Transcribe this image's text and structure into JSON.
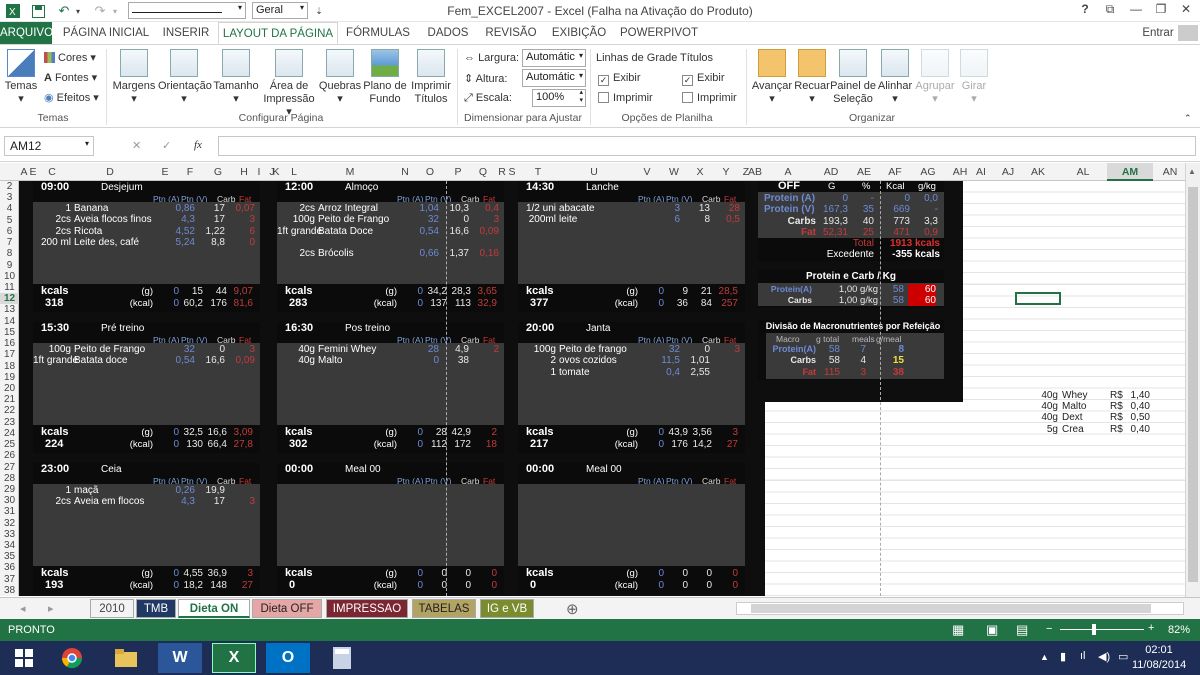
{
  "window": {
    "title": "Fem_EXCEL2007 - Excel (Falha na Ativação do Produto)",
    "help": "?",
    "signin": "Entrar"
  },
  "qat": {
    "font_box": "",
    "size_box": "Geral"
  },
  "ribbon_tabs": [
    "ARQUIVO",
    "PÁGINA INICIAL",
    "INSERIR",
    "LAYOUT DA PÁGINA",
    "FÓRMULAS",
    "DADOS",
    "REVISÃO",
    "EXIBIÇÃO",
    "POWERPIVOT"
  ],
  "ribbon": {
    "temas": "Temas",
    "cores": "Cores",
    "fontes": "Fontes",
    "efeitos": "Efeitos",
    "temas_group": "Temas",
    "margens": "Margens",
    "orientacao": "Orientação",
    "tamanho": "Tamanho",
    "area1": "Área de",
    "area2": "Impressão",
    "quebras": "Quebras",
    "plano1": "Plano de",
    "plano2": "Fundo",
    "imprimir1": "Imprimir",
    "imprimir2": "Títulos",
    "config_group": "Configurar Página",
    "largura": "Largura:",
    "largura_val": "Automátic",
    "altura": "Altura:",
    "altura_val": "Automátic",
    "escala": "Escala:",
    "escala_val": "100%",
    "dim_group": "Dimensionar para Ajustar",
    "linhas": "Linhas de Grade",
    "titulos": "Títulos",
    "exibir": "Exibir",
    "imprimir": "Imprimir",
    "opcoes_group": "Opções de Planilha",
    "avancar": "Avançar",
    "recuar": "Recuar",
    "painel1": "Painel de",
    "painel2": "Seleção",
    "alinhar": "Alinhar",
    "agrupar": "Agrupar",
    "girar": "Girar",
    "organizar_group": "Organizar"
  },
  "formula_bar": {
    "name_box": "AM12",
    "fx": "fx",
    "cancel": "✕",
    "enter": "✓"
  },
  "columns": [
    "A",
    "E",
    "C",
    "D",
    "E",
    "F",
    "G",
    "H",
    "I",
    "J",
    "K",
    "L",
    "M",
    "N",
    "O",
    "P",
    "Q",
    "R",
    "S",
    "T",
    "U",
    "V",
    "W",
    "X",
    "Y",
    "Z",
    "AB",
    "A",
    "AD",
    "AE",
    "AF",
    "AG",
    "AH",
    "AI",
    "AJ",
    "AK",
    "AL",
    "AM",
    "AN",
    "AO",
    "AP"
  ],
  "rows": [
    "2",
    "3",
    "4",
    "5",
    "6",
    "7",
    "8",
    "9",
    "10",
    "11",
    "12",
    "13",
    "14",
    "15",
    "16",
    "17",
    "18",
    "19",
    "20",
    "21",
    "22",
    "23",
    "24",
    "25",
    "26",
    "27",
    "28",
    "29",
    "30",
    "31",
    "32",
    "33",
    "34",
    "35",
    "36",
    "37",
    "38"
  ],
  "meal_header": {
    "ptna": "Ptn (A)",
    "ptnv": "Ptn (V)",
    "carb": "Carb",
    "fat": "Fat"
  },
  "meals": [
    {
      "time": "09:00",
      "name": "Desjejum",
      "items": [
        {
          "q": "1",
          "f": "Banana",
          "a": "",
          "v": "0,86",
          "c": "17",
          "fat": "0,07"
        },
        {
          "q": "2cs",
          "f": "Aveia flocos finos",
          "a": "",
          "v": "4,3",
          "c": "17",
          "fat": "3"
        },
        {
          "q": "2cs",
          "f": "Ricota",
          "a": "",
          "v": "4,52",
          "c": "1,22",
          "fat": "6"
        },
        {
          "q": "200 ml",
          "f": "Leite des, café",
          "a": "",
          "v": "5,24",
          "c": "8,8",
          "fat": "0"
        }
      ],
      "g": [
        "0",
        "15",
        "44",
        "9,07"
      ],
      "k": [
        "318",
        "0",
        "60,2",
        "176",
        "81,6"
      ]
    },
    {
      "time": "12:00",
      "name": "Almoço",
      "items": [
        {
          "q": "2cs",
          "f": "Arroz Integral",
          "a": "",
          "v": "1,04",
          "c": "10,3",
          "fat": "0,4"
        },
        {
          "q": "100g",
          "f": "Peito de Frango",
          "a": "",
          "v": "32",
          "c": "0",
          "fat": "3"
        },
        {
          "q": "1ft grande",
          "f": "Batata Doce",
          "a": "",
          "v": "0,54",
          "c": "16,6",
          "fat": "0,09"
        },
        {
          "q": "",
          "f": "",
          "a": "",
          "v": "",
          "c": "",
          "fat": ""
        },
        {
          "q": "2cs",
          "f": "Brócolis",
          "a": "",
          "v": "0,66",
          "c": "1,37",
          "fat": "0,16"
        }
      ],
      "g": [
        "0",
        "34,2",
        "28,3",
        "3,65"
      ],
      "k": [
        "283",
        "0",
        "137",
        "113",
        "32,9"
      ]
    },
    {
      "time": "14:30",
      "name": "Lanche",
      "items": [
        {
          "q": "1/2 uni",
          "f": "abacate",
          "a": "",
          "v": "3",
          "c": "13",
          "fat": "28"
        },
        {
          "q": "200ml",
          "f": "leite",
          "a": "",
          "v": "6",
          "c": "8",
          "fat": "0,5"
        }
      ],
      "g": [
        "0",
        "9",
        "21",
        "28,5"
      ],
      "k": [
        "377",
        "0",
        "36",
        "84",
        "257"
      ]
    },
    {
      "time": "15:30",
      "name": "Pré treino",
      "items": [
        {
          "q": "100g",
          "f": "Peito de Frango",
          "a": "",
          "v": "32",
          "c": "0",
          "fat": "3"
        },
        {
          "q": "1ft grande",
          "f": "Batata doce",
          "a": "",
          "v": "0,54",
          "c": "16,6",
          "fat": "0,09"
        }
      ],
      "g": [
        "0",
        "32,5",
        "16,6",
        "3,09"
      ],
      "k": [
        "224",
        "0",
        "130",
        "66,4",
        "27,8"
      ]
    },
    {
      "time": "16:30",
      "name": "Pos treino",
      "items": [
        {
          "q": "40g",
          "f": "Femini Whey",
          "a": "",
          "v": "28",
          "c": "4,9",
          "fat": "2"
        },
        {
          "q": "40g",
          "f": "Malto",
          "a": "",
          "v": "0",
          "c": "38",
          "fat": ""
        }
      ],
      "g": [
        "0",
        "28",
        "42,9",
        "2"
      ],
      "k": [
        "302",
        "0",
        "112",
        "172",
        "18"
      ]
    },
    {
      "time": "20:00",
      "name": "Janta",
      "items": [
        {
          "q": "100g",
          "f": "Peito de frango",
          "a": "",
          "v": "32",
          "c": "0",
          "fat": "3"
        },
        {
          "q": "2",
          "f": "ovos cozidos",
          "a": "",
          "v": "11,5",
          "c": "1,01",
          "fat": ""
        },
        {
          "q": "1",
          "f": "tomate",
          "a": "",
          "v": "0,4",
          "c": "2,55",
          "fat": ""
        }
      ],
      "g": [
        "0",
        "43,9",
        "3,56",
        "3"
      ],
      "k": [
        "217",
        "0",
        "176",
        "14,2",
        "27"
      ]
    },
    {
      "time": "23:00",
      "name": "Ceia",
      "items": [
        {
          "q": "1",
          "f": "maçã",
          "a": "",
          "v": "0,26",
          "c": "19,9",
          "fat": ""
        },
        {
          "q": "2cs",
          "f": "Aveia em flocos",
          "a": "",
          "v": "4,3",
          "c": "17",
          "fat": "3"
        }
      ],
      "g": [
        "0",
        "4,55",
        "36,9",
        "3"
      ],
      "k": [
        "193",
        "0",
        "18,2",
        "148",
        "27"
      ]
    },
    {
      "time": "00:00",
      "name": "Meal 00",
      "items": [],
      "g": [
        "0",
        "0",
        "0",
        "0"
      ],
      "k": [
        "0",
        "0",
        "0",
        "0",
        "0"
      ]
    },
    {
      "time": "00:00",
      "name": "Meal 00",
      "items": [],
      "g": [
        "0",
        "0",
        "0",
        "0"
      ],
      "k": [
        "0",
        "0",
        "0",
        "0",
        "0"
      ]
    }
  ],
  "kcals_label": "kcals",
  "g_label": "(g)",
  "kcal_label": "(kcal)",
  "summary": {
    "off": "OFF",
    "h_g": "G",
    "h_pct": "%",
    "h_kcal": "Kcal",
    "h_gkg": "g/kg",
    "rows": [
      {
        "n": "Protein (A)",
        "g": "0",
        "p": "-",
        "k": "0",
        "gk": "0,0"
      },
      {
        "n": "Protein (V)",
        "g": "167,3",
        "p": "35",
        "k": "669",
        "gk": "-"
      },
      {
        "n": "Carbs",
        "g": "193,3",
        "p": "40",
        "k": "773",
        "gk": "3,3"
      },
      {
        "n": "Fat",
        "g": "52,31",
        "p": "25",
        "k": "471",
        "gk": "0,9"
      }
    ],
    "total_label": "Total",
    "total_val": "1913 kcals",
    "exc_label": "Excedente",
    "exc_val": "-355 kcals"
  },
  "pck": {
    "title": "Protein e Carb / Kg",
    "rows": [
      {
        "n": "Protein(A)",
        "v": "1,00 g/kg",
        "x": "58",
        "y": "60"
      },
      {
        "n": "Carbs",
        "v": "1,00 g/kg",
        "x": "58",
        "y": "60"
      }
    ]
  },
  "div": {
    "title": "Divisão de Macronutrientes por Refeição",
    "h": [
      "Macro",
      "g total",
      "meals",
      "g/meal"
    ],
    "rows": [
      {
        "n": "Protein(A)",
        "a": "58",
        "b": "7",
        "c": "8"
      },
      {
        "n": "Carbs",
        "a": "58",
        "b": "4",
        "c": "15"
      },
      {
        "n": "Fat",
        "a": "115",
        "b": "3",
        "c": "38"
      }
    ]
  },
  "right_cells": [
    {
      "q": "40g",
      "n": "Whey",
      "p": "R$",
      "v": "1,40"
    },
    {
      "q": "40g",
      "n": "Malto",
      "p": "R$",
      "v": "0,40"
    },
    {
      "q": "40g",
      "n": "Dext",
      "p": "R$",
      "v": "0,50"
    },
    {
      "q": "5g",
      "n": "Crea",
      "p": "R$",
      "v": "0,40"
    }
  ],
  "sheets": [
    "2010",
    "TMB",
    "Dieta ON",
    "Dieta OFF",
    "IMPRESSAO",
    "TABELAS",
    "IG e VB"
  ],
  "status": {
    "ready": "PRONTO",
    "zoom": "82%"
  },
  "clock": {
    "time": "02:01",
    "date": "11/08/2014"
  },
  "colors": {
    "excel_green": "#217346",
    "taskbar": "#1d2d56"
  }
}
